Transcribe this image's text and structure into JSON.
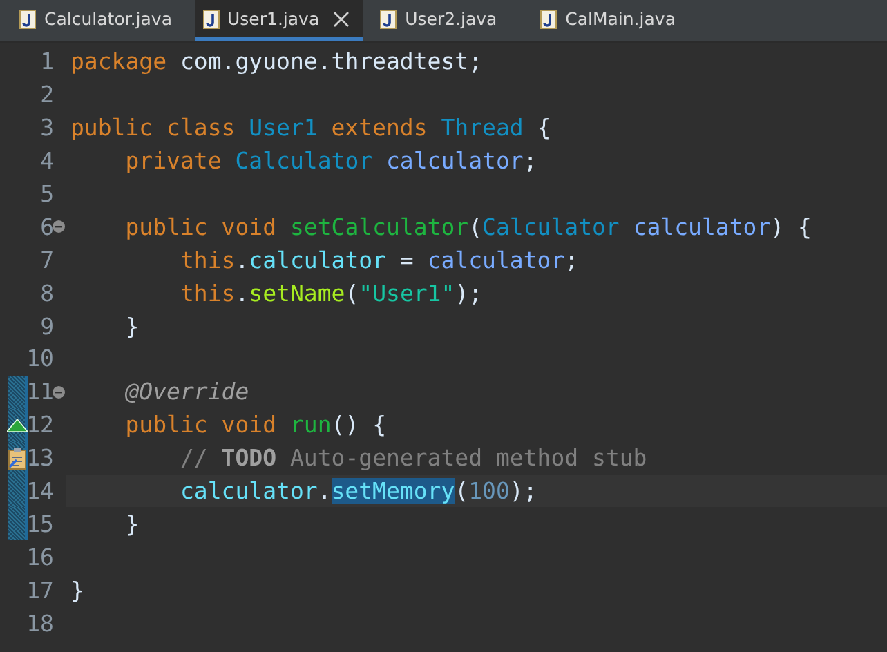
{
  "tabs": [
    {
      "label": "Calculator.java",
      "selected": false
    },
    {
      "label": "User1.java",
      "selected": true
    },
    {
      "label": "User2.java",
      "selected": false
    },
    {
      "label": "CalMain.java",
      "selected": false
    }
  ],
  "lines": [
    {
      "number": "1",
      "changed": false,
      "current": false,
      "tokens": [
        {
          "kind": "keyword",
          "text": "package "
        },
        {
          "kind": "plain",
          "text": "com.gyuone.threadtest;"
        }
      ]
    },
    {
      "number": "2",
      "changed": false,
      "current": false
    },
    {
      "number": "3",
      "changed": false,
      "current": false,
      "tokens": [
        {
          "kind": "keyword",
          "text": "public class "
        },
        {
          "kind": "classname",
          "text": "User1 "
        },
        {
          "kind": "keyword",
          "text": "extends "
        },
        {
          "kind": "type",
          "text": "Thread "
        },
        {
          "kind": "plain",
          "text": "{"
        }
      ]
    },
    {
      "number": "4",
      "changed": false,
      "current": false,
      "tokens": [
        {
          "kind": "keyword",
          "text": "    private "
        },
        {
          "kind": "type",
          "text": "Calculator "
        },
        {
          "kind": "param",
          "text": "calculator"
        },
        {
          "kind": "plain",
          "text": ";"
        }
      ]
    },
    {
      "number": "5",
      "changed": false,
      "current": false
    },
    {
      "number": "6",
      "marker": {
        "kind": "fold"
      },
      "changed": false,
      "current": false,
      "tokens": [
        {
          "kind": "keyword",
          "text": "    public void "
        },
        {
          "kind": "method",
          "text": "setCalculator"
        },
        {
          "kind": "plain",
          "text": "("
        },
        {
          "kind": "type",
          "text": "Calculator "
        },
        {
          "kind": "param",
          "text": "calculator"
        },
        {
          "kind": "plain",
          "text": ") {"
        }
      ]
    },
    {
      "number": "7",
      "changed": false,
      "current": false,
      "tokens": [
        {
          "kind": "keyword",
          "text": "        this"
        },
        {
          "kind": "plain",
          "text": "."
        },
        {
          "kind": "field",
          "text": "calculator"
        },
        {
          "kind": "plain",
          "text": " = "
        },
        {
          "kind": "param",
          "text": "calculator"
        },
        {
          "kind": "plain",
          "text": ";"
        }
      ]
    },
    {
      "number": "8",
      "changed": false,
      "current": false,
      "tokens": [
        {
          "kind": "keyword",
          "text": "        this"
        },
        {
          "kind": "plain",
          "text": "."
        },
        {
          "kind": "call",
          "text": "setName"
        },
        {
          "kind": "plain",
          "text": "("
        },
        {
          "kind": "string",
          "text": "\"User1\""
        },
        {
          "kind": "plain",
          "text": ");"
        }
      ]
    },
    {
      "number": "9",
      "changed": false,
      "current": false,
      "tokens": [
        {
          "kind": "plain",
          "text": "    }"
        }
      ]
    },
    {
      "number": "10",
      "changed": false,
      "current": false
    },
    {
      "number": "11",
      "marker": {
        "kind": "fold"
      },
      "changed": true,
      "current": false,
      "tokens": [
        {
          "kind": "annotation",
          "text": "    @Override"
        }
      ]
    },
    {
      "number": "12",
      "marker": {
        "kind": "override"
      },
      "changed": true,
      "current": false,
      "tokens": [
        {
          "kind": "keyword",
          "text": "    public void "
        },
        {
          "kind": "method",
          "text": "run"
        },
        {
          "kind": "plain",
          "text": "() {"
        }
      ]
    },
    {
      "number": "13",
      "marker": {
        "kind": "task"
      },
      "changed": true,
      "current": false,
      "tokens": [
        {
          "kind": "comment",
          "text": "        // "
        },
        {
          "kind": "todo",
          "text": "TODO"
        },
        {
          "kind": "comment",
          "text": " Auto-generated method stub"
        }
      ]
    },
    {
      "number": "14",
      "changed": true,
      "current": true,
      "tokens": [
        {
          "kind": "field",
          "text": "        calculator"
        },
        {
          "kind": "plain",
          "text": "."
        },
        {
          "kind": "selected",
          "text": "setMemory"
        },
        {
          "kind": "plain",
          "text": "("
        },
        {
          "kind": "number",
          "text": "100"
        },
        {
          "kind": "plain",
          "text": ");"
        }
      ]
    },
    {
      "number": "15",
      "changed": true,
      "current": false,
      "tokens": [
        {
          "kind": "plain",
          "text": "    }"
        }
      ]
    },
    {
      "number": "16",
      "changed": false,
      "current": false
    },
    {
      "number": "17",
      "changed": false,
      "current": false,
      "tokens": [
        {
          "kind": "plain",
          "text": "}"
        }
      ]
    },
    {
      "number": "18",
      "changed": false,
      "current": false
    }
  ]
}
